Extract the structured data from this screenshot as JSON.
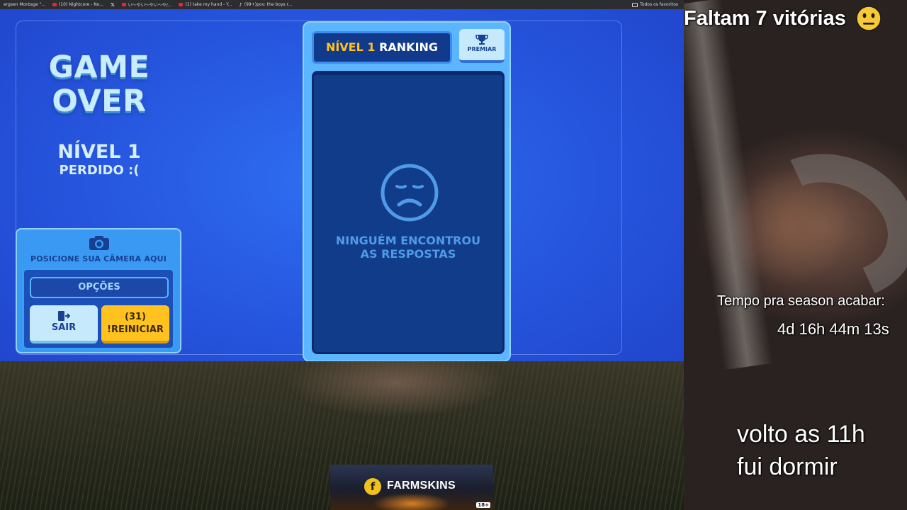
{
  "bookmarks": [
    {
      "label": "ergsen Montage \"..."
    },
    {
      "label": "(10) Nightcore - No..."
    },
    {
      "label": ""
    },
    {
      "label": "い〜やい〜やい〜や/..."
    },
    {
      "label": "(1) take my hand - Y..."
    },
    {
      "label": "(99+)pov: the boys r..."
    }
  ],
  "bookmarks_folder": "Todos os favoritos",
  "game": {
    "title": "GAME OVER",
    "level_label": "NÍVEL 1",
    "level_status": "PERDIDO :(",
    "camera_hint": "POSICIONE SUA CÂMERA AQUI",
    "options_label": "OPÇÕES",
    "exit_label": "SAIR",
    "restart_count": "(31)",
    "restart_label": "!REINICIAR",
    "ranking": {
      "level": "NÍVEL 1",
      "title": "RANKING",
      "award_label": "PREMIAR",
      "empty_line1": "NINGUÉM ENCONTROU",
      "empty_line2": "AS RESPOSTAS"
    }
  },
  "overlay": {
    "wins_text": "Faltam 7 vitórias",
    "wins_emoji": "neutral-face-emoji",
    "season_label": "Tempo pra season acabar:",
    "season_time": "4d 16h 44m 13s",
    "away_line1": "volto as 11h",
    "away_line2": "fui dormir"
  },
  "sponsor": {
    "name": "FARMSKINS",
    "age_badge": "18+"
  },
  "colors": {
    "game_blue": "#2758e0",
    "accent_yellow": "#ffc21f",
    "panel_dark": "#113c8a",
    "text_light_blue": "#c9ecff"
  }
}
